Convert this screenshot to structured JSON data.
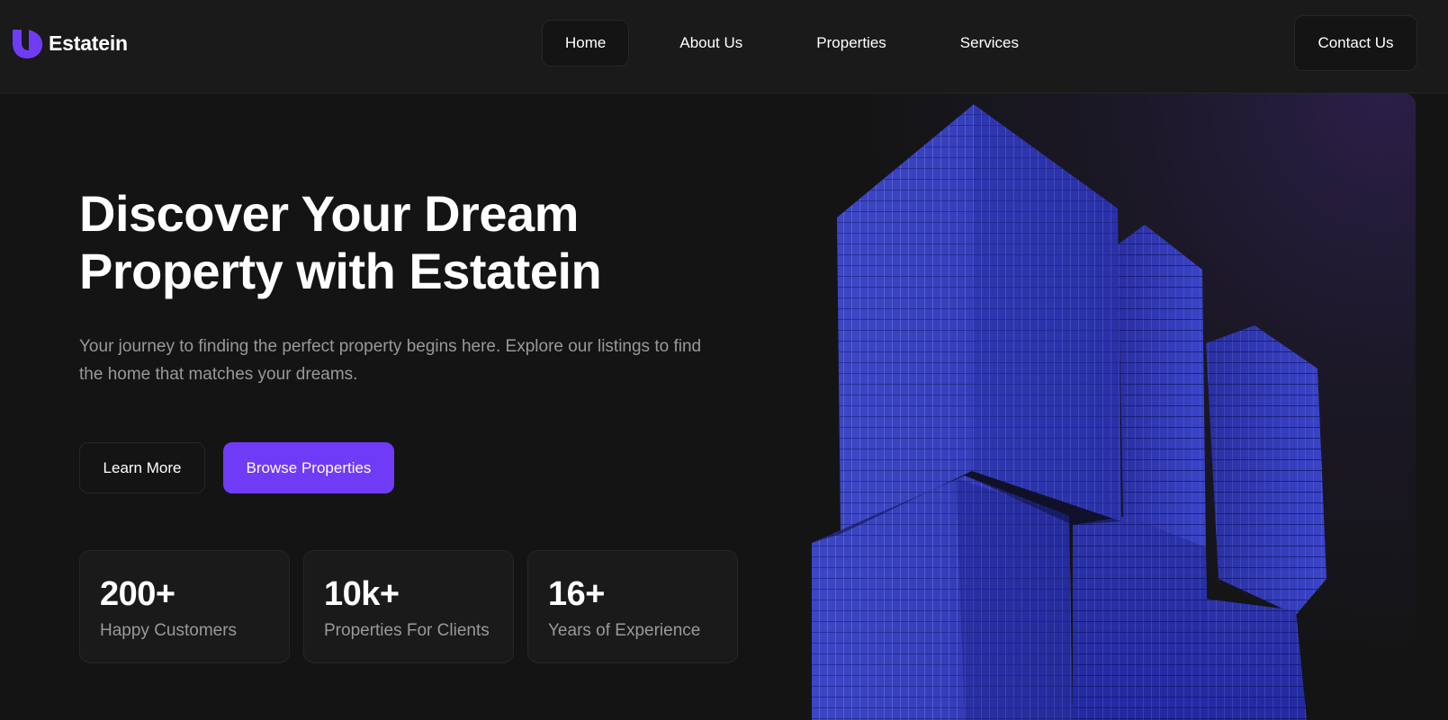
{
  "brand": {
    "name": "Estatein",
    "accent_color": "#703bf7"
  },
  "nav": {
    "items": [
      {
        "label": "Home",
        "active": true
      },
      {
        "label": "About Us",
        "active": false
      },
      {
        "label": "Properties",
        "active": false
      },
      {
        "label": "Services",
        "active": false
      }
    ],
    "contact_label": "Contact Us"
  },
  "hero": {
    "title_line1": "Discover Your Dream",
    "title_line2": "Property with Estatein",
    "desc_line1": "Your journey to finding the perfect property begins here. Explore our listings to find",
    "desc_line2": "the home that matches your dreams.",
    "learn_more_label": "Learn More",
    "browse_label": "Browse Properties",
    "stats": [
      {
        "value": "200+",
        "label": "Happy Customers"
      },
      {
        "value": "10k+",
        "label": "Properties For Clients"
      },
      {
        "value": "16+",
        "label": "Years of Experience"
      }
    ]
  }
}
